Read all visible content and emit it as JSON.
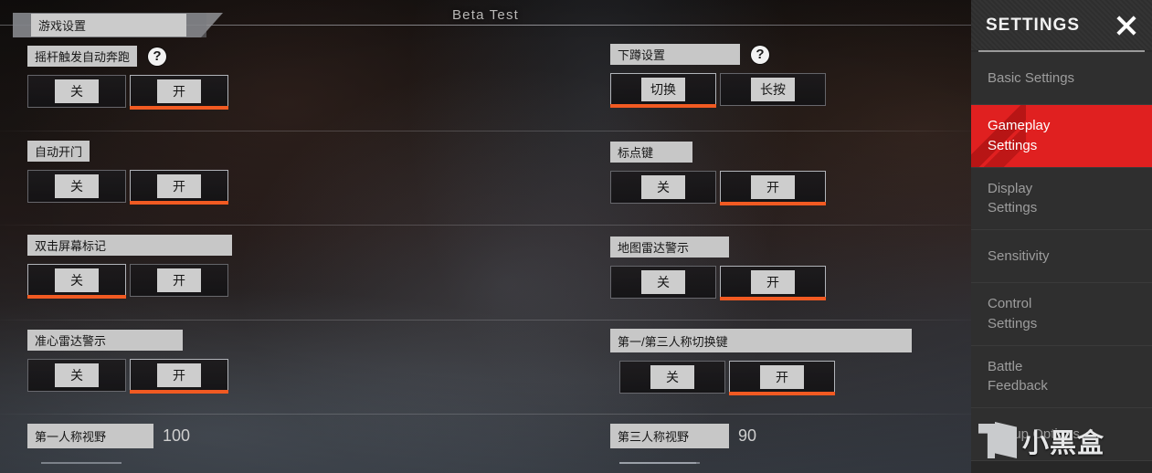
{
  "header": {
    "beta_label": "Beta Test",
    "tab_label": "游戏设置"
  },
  "sidebar": {
    "title": "SETTINGS",
    "close_icon": "close-x-icon",
    "accent_color": "#e02020",
    "items": [
      {
        "label": "Basic Settings",
        "active": false
      },
      {
        "label": "Gameplay\nSettings",
        "active": true
      },
      {
        "label": "Display\nSettings",
        "active": false
      },
      {
        "label": "Sensitivity",
        "active": false
      },
      {
        "label": "Control\nSettings",
        "active": false
      },
      {
        "label": "Battle\nFeedback",
        "active": false
      },
      {
        "label": "Pickup Options",
        "active": false
      }
    ]
  },
  "watermark": {
    "text": "小黑盒",
    "logo_icon": "hei-he-logo-icon"
  },
  "theme": {
    "selected_underline": "#f15a22",
    "label_bg": "#c7c7c7",
    "cap_bg": "#cdcdcd"
  },
  "settings": {
    "left_column": [
      {
        "label": "摇杆触发自动奔跑",
        "help": "?",
        "has_help": true,
        "options": [
          {
            "text": "关",
            "selected": false
          },
          {
            "text": "开",
            "selected": true
          }
        ]
      },
      {
        "label": "自动开门",
        "has_help": false,
        "options": [
          {
            "text": "关",
            "selected": false
          },
          {
            "text": "开",
            "selected": true
          }
        ]
      },
      {
        "label": "双击屏幕标记",
        "has_help": false,
        "options": [
          {
            "text": "关",
            "selected": true
          },
          {
            "text": "开",
            "selected": false
          }
        ]
      },
      {
        "label": "准心雷达警示",
        "has_help": false,
        "options": [
          {
            "text": "关",
            "selected": false
          },
          {
            "text": "开",
            "selected": true
          }
        ]
      }
    ],
    "left_slider": {
      "label": "第一人称视野",
      "value": "100"
    },
    "right_column": [
      {
        "label": "下蹲设置",
        "help": "?",
        "has_help": true,
        "options": [
          {
            "text": "切换",
            "selected": true
          },
          {
            "text": "长按",
            "selected": false
          }
        ]
      },
      {
        "label": "标点键",
        "has_help": false,
        "options": [
          {
            "text": "关",
            "selected": false
          },
          {
            "text": "开",
            "selected": true
          }
        ]
      },
      {
        "label": "地图雷达警示",
        "has_help": false,
        "options": [
          {
            "text": "关",
            "selected": false
          },
          {
            "text": "开",
            "selected": true
          }
        ]
      },
      {
        "label": "第一/第三人称切换键",
        "has_help": false,
        "options": [
          {
            "text": "关",
            "selected": false
          },
          {
            "text": "开",
            "selected": true
          }
        ]
      }
    ],
    "right_slider": {
      "label": "第三人称视野",
      "value": "90"
    }
  }
}
